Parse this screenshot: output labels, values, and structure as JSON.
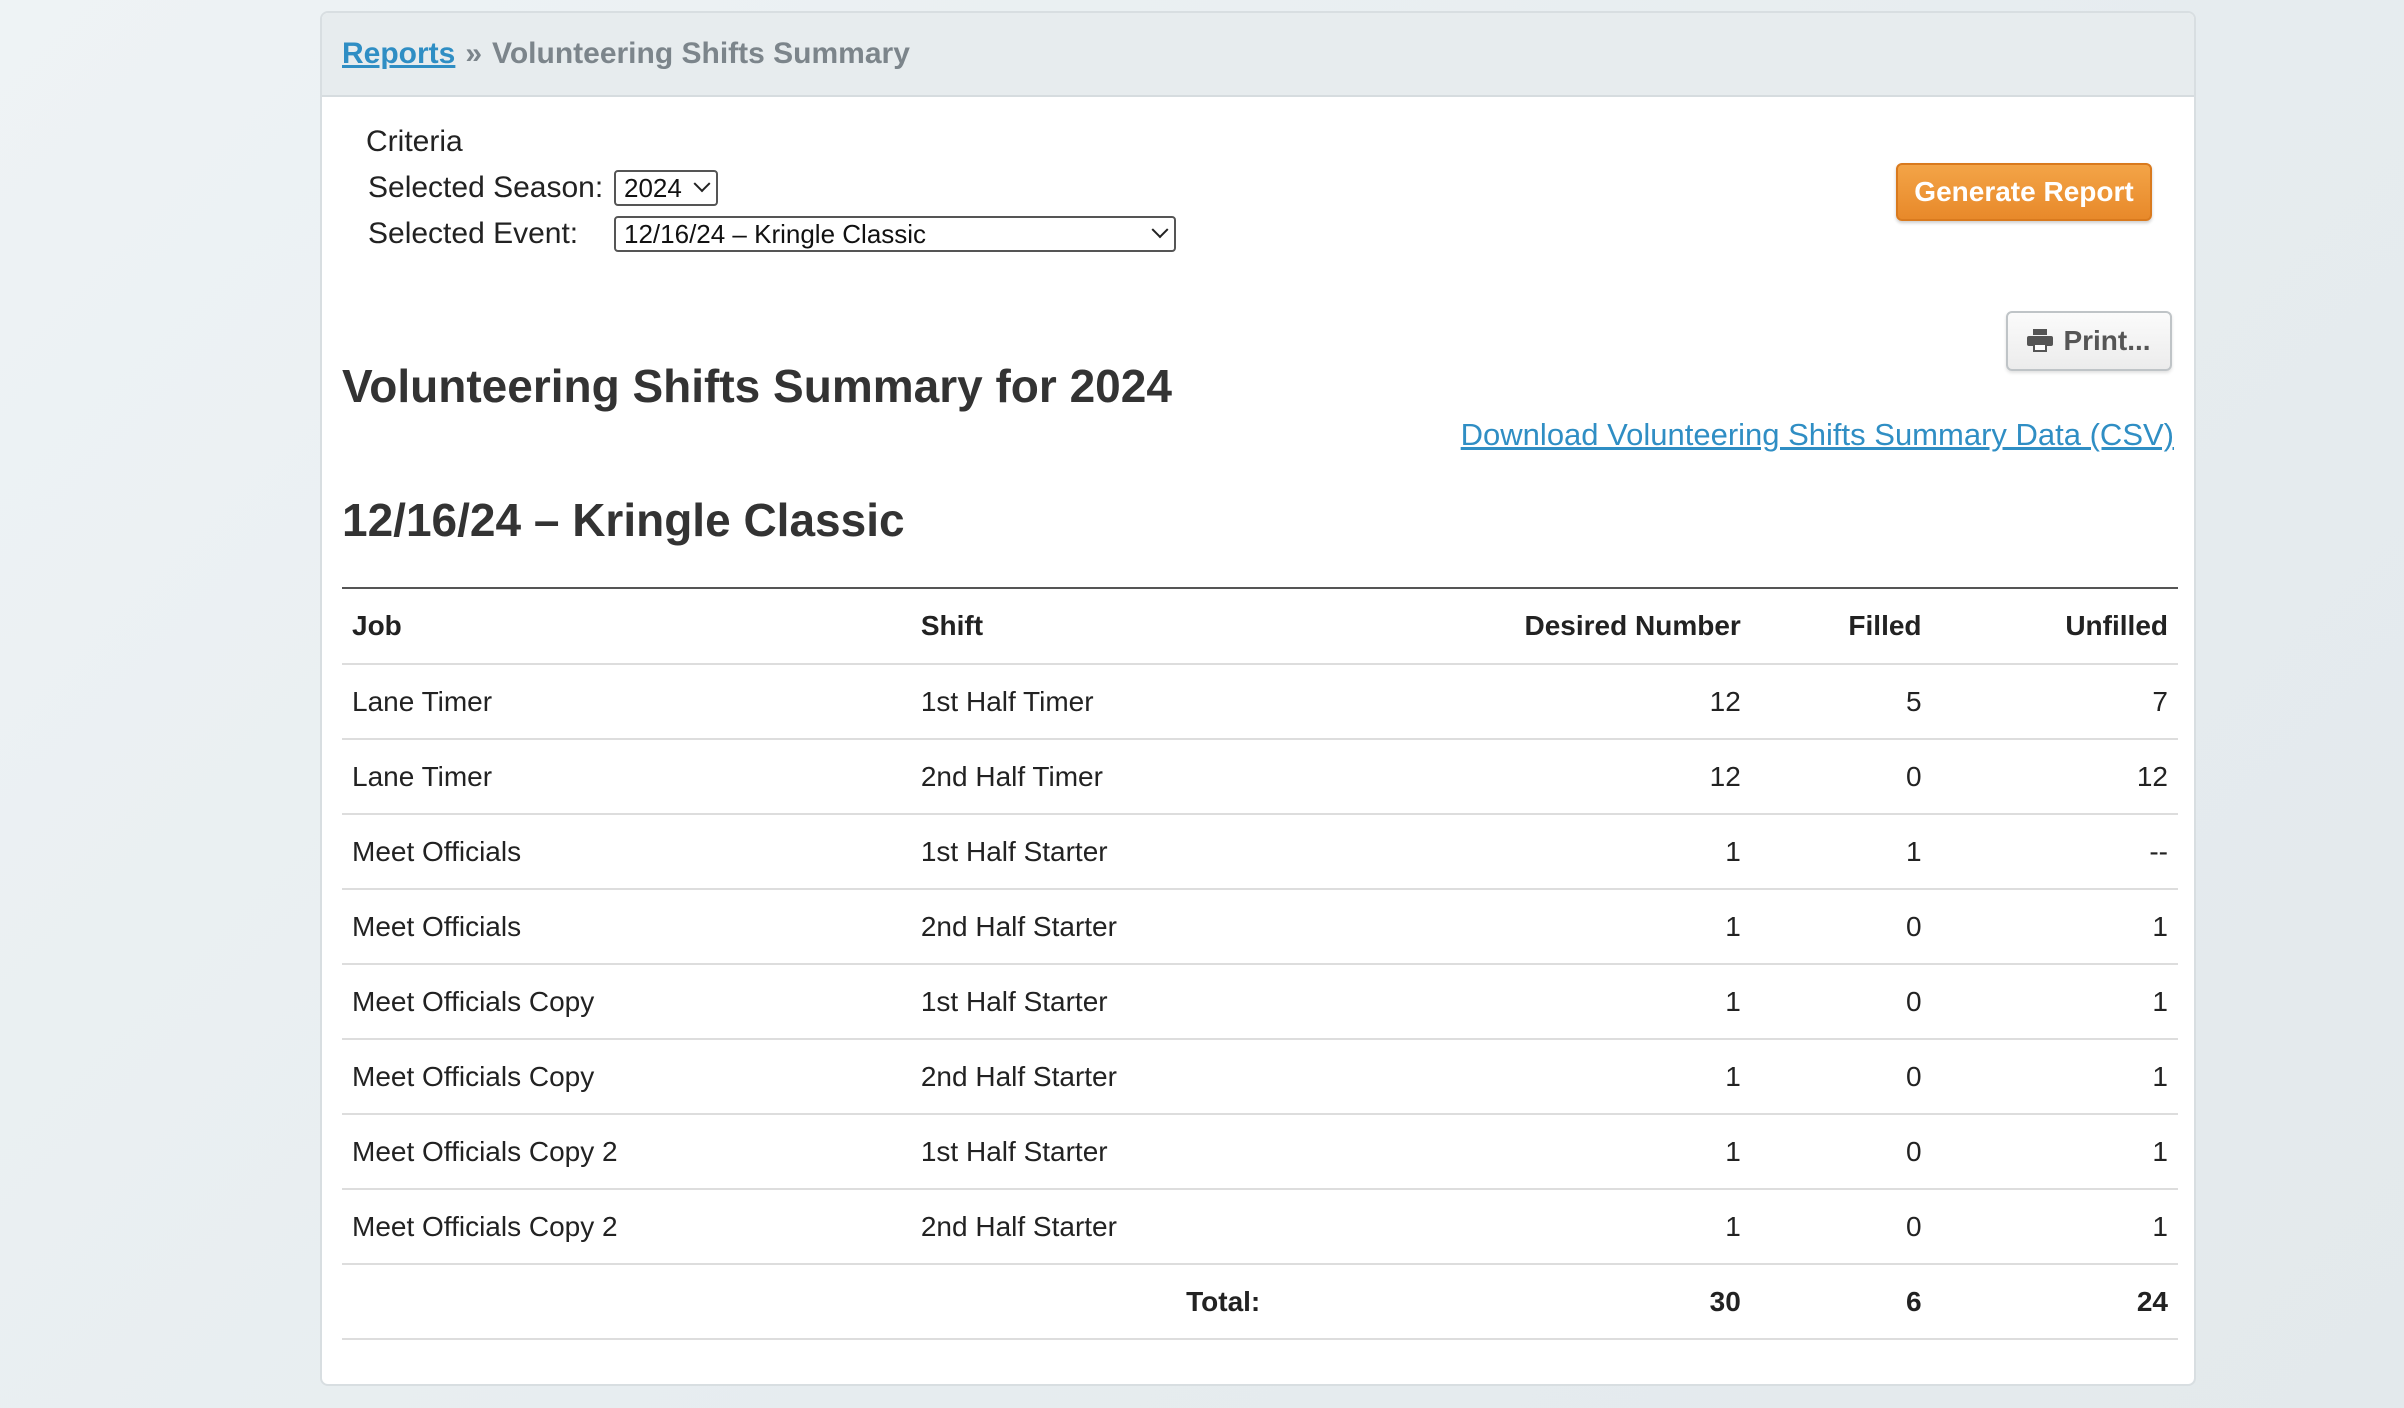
{
  "breadcrumb": {
    "link": "Reports",
    "separator": "»",
    "current": "Volunteering Shifts Summary"
  },
  "criteria": {
    "title": "Criteria",
    "season_label": "Selected Season:",
    "season_value": "2024",
    "event_label": "Selected Event:",
    "event_value": "12/16/24 – Kringle Classic"
  },
  "buttons": {
    "generate": "Generate Report",
    "print": "Print..."
  },
  "report": {
    "title": "Volunteering Shifts Summary for 2024",
    "csv_link": "Download Volunteering Shifts Summary Data (CSV)",
    "event_title": "12/16/24 – Kringle Classic"
  },
  "table": {
    "headers": {
      "job": "Job",
      "shift": "Shift",
      "desired": "Desired Number",
      "filled": "Filled",
      "unfilled": "Unfilled"
    },
    "rows": [
      {
        "job": "Lane Timer",
        "shift": "1st Half Timer",
        "desired": "12",
        "filled": "5",
        "unfilled": "7"
      },
      {
        "job": "Lane Timer",
        "shift": "2nd Half Timer",
        "desired": "12",
        "filled": "0",
        "unfilled": "12"
      },
      {
        "job": "Meet Officials",
        "shift": "1st Half Starter",
        "desired": "1",
        "filled": "1",
        "unfilled": "--"
      },
      {
        "job": "Meet Officials",
        "shift": "2nd Half Starter",
        "desired": "1",
        "filled": "0",
        "unfilled": "1"
      },
      {
        "job": "Meet Officials Copy",
        "shift": "1st Half Starter",
        "desired": "1",
        "filled": "0",
        "unfilled": "1"
      },
      {
        "job": "Meet Officials Copy",
        "shift": "2nd Half Starter",
        "desired": "1",
        "filled": "0",
        "unfilled": "1"
      },
      {
        "job": "Meet Officials Copy 2",
        "shift": "1st Half Starter",
        "desired": "1",
        "filled": "0",
        "unfilled": "1"
      },
      {
        "job": "Meet Officials Copy 2",
        "shift": "2nd Half Starter",
        "desired": "1",
        "filled": "0",
        "unfilled": "1"
      }
    ],
    "total": {
      "label": "Total:",
      "desired": "30",
      "filled": "6",
      "unfilled": "24"
    }
  },
  "colors": {
    "link": "#2f8ec4",
    "accent_button": "#e8892a"
  }
}
